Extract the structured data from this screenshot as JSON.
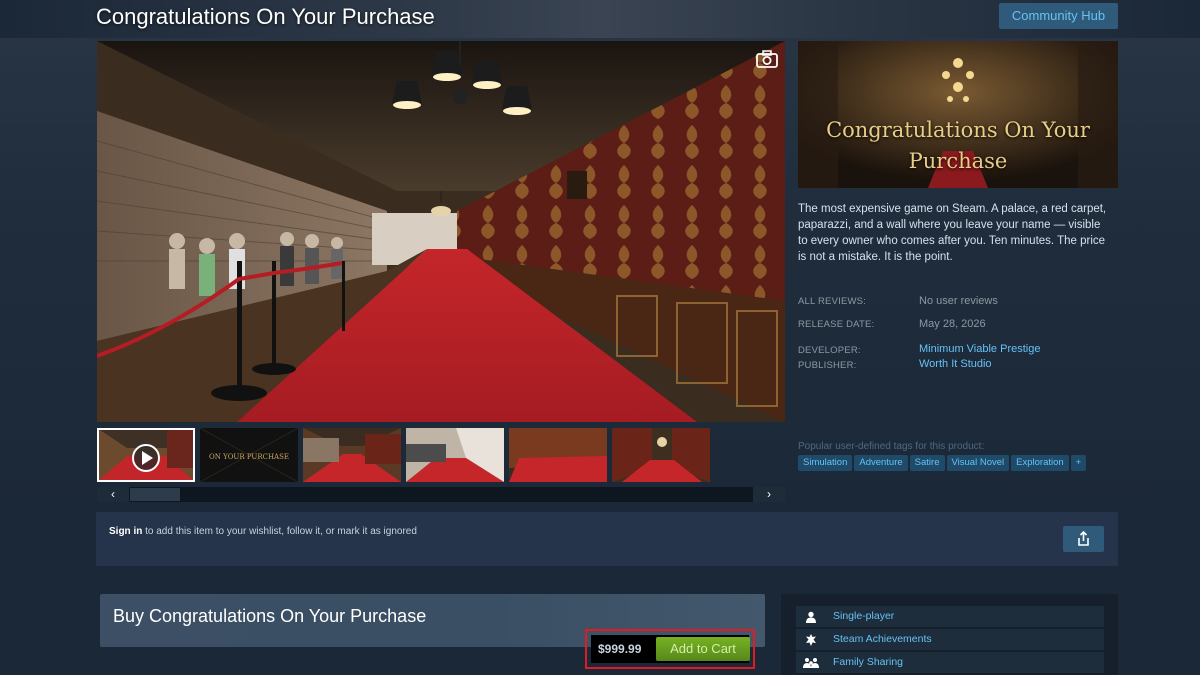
{
  "page": {
    "title": "Congratulations On Your Purchase",
    "community_hub_label": "Community Hub"
  },
  "media": {
    "capsule_title_line1": "Congratulations On Your",
    "capsule_title_line2": "Purchase",
    "scroll_left": "‹",
    "scroll_right": "›",
    "thumb_caption": "ON YOUR PURCHASE"
  },
  "info": {
    "description": "The most expensive game on Steam. A palace, a red carpet, paparazzi, and a wall where you leave your name — visible to every owner who comes after you. Ten minutes. The price is not a mistake. It is the point.",
    "reviews_label": "ALL REVIEWS:",
    "reviews_value": "No user reviews",
    "release_label": "RELEASE DATE:",
    "release_value": "May 28, 2026",
    "developer_label": "DEVELOPER:",
    "developer_value": "Minimum Viable Prestige",
    "publisher_label": "PUBLISHER:",
    "publisher_value": "Worth It Studio",
    "tags_label": "Popular user-defined tags for this product:",
    "tags": [
      "Simulation",
      "Adventure",
      "Satire",
      "Visual Novel",
      "Exploration",
      "+"
    ]
  },
  "signin": {
    "link": "Sign in",
    "text": " to add this item to your wishlist, follow it, or mark it as ignored"
  },
  "buy": {
    "title": "Buy Congratulations On Your Purchase",
    "price": "$999.99",
    "add_to_cart": "Add to Cart"
  },
  "features": [
    {
      "label": "Single-player",
      "icon": "user-icon"
    },
    {
      "label": "Steam Achievements",
      "icon": "achievement-icon"
    },
    {
      "label": "Family Sharing",
      "icon": "family-icon"
    }
  ],
  "colors": {
    "background": "#1b2838",
    "link": "#67c1f5",
    "cart_green": "#75b022",
    "highlight_red": "#e01b24",
    "capsule_gold": "#e8cd86"
  }
}
